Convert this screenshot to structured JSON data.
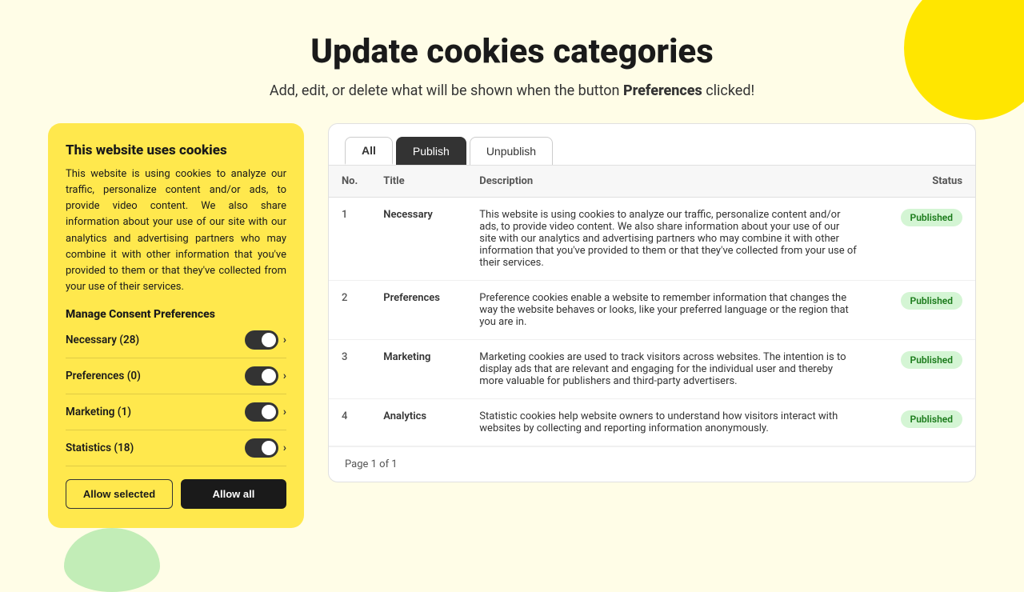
{
  "page": {
    "title": "Update cookies categories",
    "subtitle_start": "Add, edit, or delete what will be shown when the button ",
    "subtitle_bold": "Preferences",
    "subtitle_end": " clicked!"
  },
  "cookie_card": {
    "title": "This website uses cookies",
    "description": "This website is using cookies to analyze our traffic, personalize content and/or ads, to provide video content. We also share information about your use of our site with our analytics and advertising partners who may combine it with other information that you've provided to them or that they've collected from your use of their services.",
    "manage_title": "Manage Consent Preferences",
    "preferences": [
      {
        "label": "Necessary (28)",
        "enabled": true
      },
      {
        "label": "Preferences (0)",
        "enabled": true
      },
      {
        "label": "Marketing (1)",
        "enabled": true
      },
      {
        "label": "Statistics (18)",
        "enabled": true
      }
    ],
    "btn_allow_selected": "Allow selected",
    "btn_allow_all": "Allow all"
  },
  "table": {
    "tabs": [
      {
        "label": "All",
        "active": true
      },
      {
        "label": "Publish",
        "special": true
      },
      {
        "label": "Unpublish",
        "active": false
      }
    ],
    "columns": [
      "No.",
      "Title",
      "Description",
      "Status"
    ],
    "rows": [
      {
        "no": "1",
        "title": "Necessary",
        "description": "This website is using cookies to analyze our traffic, personalize content and/or ads, to provide video content. We also share information about your use of our site with our analytics and advertising partners who may combine it with other information that you've provided to them or that they've collected from your use of their services.",
        "status": "Published"
      },
      {
        "no": "2",
        "title": "Preferences",
        "description": "Preference cookies enable a website to remember information that changes the way the website behaves or looks, like your preferred language or the region that you are in.",
        "status": "Published"
      },
      {
        "no": "3",
        "title": "Marketing",
        "description": "Marketing cookies are used to track visitors across websites. The intention is to display ads that are relevant and engaging for the individual user and thereby more valuable for publishers and third-party advertisers.",
        "status": "Published"
      },
      {
        "no": "4",
        "title": "Analytics",
        "description": "Statistic cookies help website owners to understand how visitors interact with websites by collecting and reporting information anonymously.",
        "status": "Published"
      }
    ],
    "pagination": "Page 1 of 1"
  }
}
